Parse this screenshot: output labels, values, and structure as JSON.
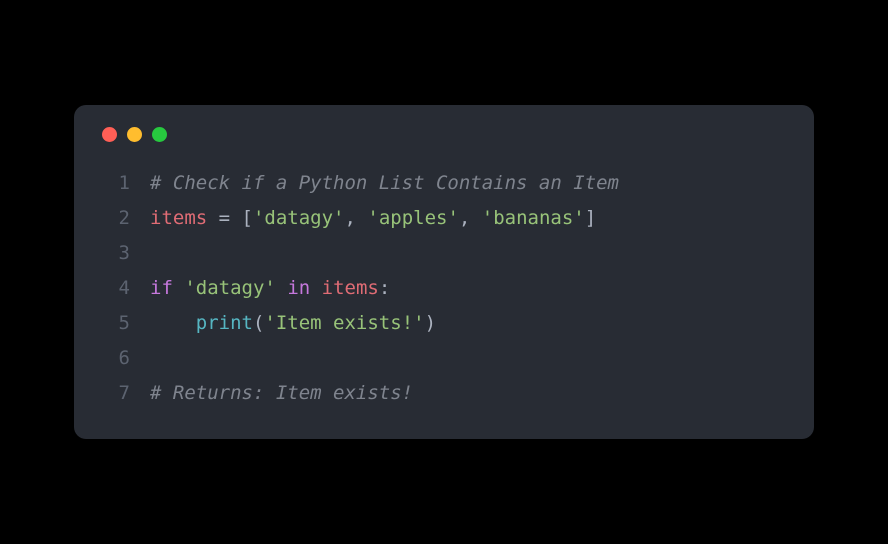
{
  "window": {
    "traffic_light_red": "#ff5f56",
    "traffic_light_yellow": "#ffbd2e",
    "traffic_light_green": "#27c93f"
  },
  "code": {
    "lines": [
      {
        "num": "1",
        "tokens": [
          {
            "cls": "tok-comment",
            "t": "# Check if a Python List Contains an Item"
          }
        ]
      },
      {
        "num": "2",
        "tokens": [
          {
            "cls": "tok-var",
            "t": "items"
          },
          {
            "cls": "tok-op",
            "t": " = "
          },
          {
            "cls": "tok-punct",
            "t": "["
          },
          {
            "cls": "tok-string",
            "t": "'datagy'"
          },
          {
            "cls": "tok-punct",
            "t": ", "
          },
          {
            "cls": "tok-string",
            "t": "'apples'"
          },
          {
            "cls": "tok-punct",
            "t": ", "
          },
          {
            "cls": "tok-string",
            "t": "'bananas'"
          },
          {
            "cls": "tok-punct",
            "t": "]"
          }
        ]
      },
      {
        "num": "3",
        "tokens": []
      },
      {
        "num": "4",
        "tokens": [
          {
            "cls": "tok-keyword",
            "t": "if"
          },
          {
            "cls": "tok-op",
            "t": " "
          },
          {
            "cls": "tok-string",
            "t": "'datagy'"
          },
          {
            "cls": "tok-op",
            "t": " "
          },
          {
            "cls": "tok-keyword",
            "t": "in"
          },
          {
            "cls": "tok-op",
            "t": " "
          },
          {
            "cls": "tok-var",
            "t": "items"
          },
          {
            "cls": "tok-punct",
            "t": ":"
          }
        ]
      },
      {
        "num": "5",
        "tokens": [
          {
            "cls": "tok-op",
            "t": "    "
          },
          {
            "cls": "tok-builtin",
            "t": "print"
          },
          {
            "cls": "tok-punct",
            "t": "("
          },
          {
            "cls": "tok-string",
            "t": "'Item exists!'"
          },
          {
            "cls": "tok-punct",
            "t": ")"
          }
        ]
      },
      {
        "num": "6",
        "tokens": []
      },
      {
        "num": "7",
        "tokens": [
          {
            "cls": "tok-comment",
            "t": "# Returns: Item exists!"
          }
        ]
      }
    ]
  }
}
